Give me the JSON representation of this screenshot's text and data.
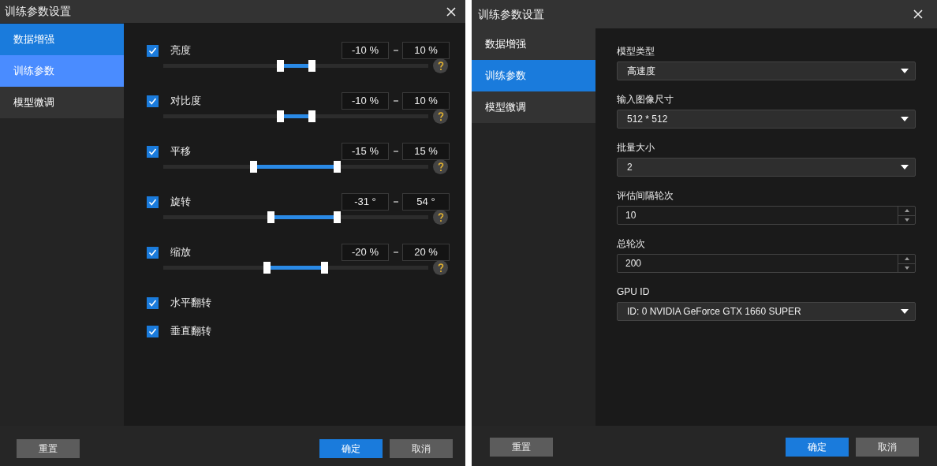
{
  "dialogs": [
    {
      "title": "训练参数设置",
      "sidebar": {
        "items": [
          {
            "label": "数据增强",
            "selected": true,
            "hovered": false
          },
          {
            "label": "训练参数",
            "selected": false,
            "hovered": true
          },
          {
            "label": "模型微调",
            "selected": false,
            "hovered": false
          }
        ]
      },
      "content": {
        "kind": "augmentation",
        "rows": [
          {
            "label": "亮度",
            "checked": true,
            "min": "-10 %",
            "max": "10 %",
            "range": [
              {
                "level": 0.44
              },
              {
                "level": 0.56
              }
            ]
          },
          {
            "label": "对比度",
            "checked": true,
            "min": "-10 %",
            "max": "10 %",
            "range": [
              {
                "level": 0.44
              },
              {
                "level": 0.56
              }
            ]
          },
          {
            "label": "平移",
            "checked": true,
            "min": "-15 %",
            "max": "15 %",
            "range": [
              {
                "level": 0.34
              },
              {
                "level": 0.655
              }
            ]
          },
          {
            "label": "旋转",
            "checked": true,
            "min": "-31 °",
            "max": "54 °",
            "range": [
              {
                "level": 0.405
              },
              {
                "level": 0.655
              }
            ]
          },
          {
            "label": "缩放",
            "checked": true,
            "min": "-20 %",
            "max": "20 %",
            "range": [
              {
                "level": 0.39
              },
              {
                "level": 0.607
              }
            ]
          },
          {
            "label": "水平翻转",
            "checked": true
          },
          {
            "label": "垂直翻转",
            "checked": true
          }
        ]
      },
      "buttons": {
        "reset": "重置",
        "ok": "确定",
        "cancel": "取消"
      }
    },
    {
      "title": "训练参数设置",
      "sidebar": {
        "items": [
          {
            "label": "数据增强",
            "selected": false,
            "hovered": false
          },
          {
            "label": "训练参数",
            "selected": true,
            "hovered": false
          },
          {
            "label": "模型微调",
            "selected": false,
            "hovered": false
          }
        ]
      },
      "content": {
        "kind": "form",
        "fields": [
          {
            "label": "模型类型",
            "kind": "dropdown",
            "value": "高速度"
          },
          {
            "label": "输入图像尺寸",
            "kind": "dropdown",
            "value": "512 * 512"
          },
          {
            "label": "批量大小",
            "kind": "dropdown",
            "value": "2"
          },
          {
            "label": "评估间隔轮次",
            "kind": "spinner",
            "value": "10"
          },
          {
            "label": "总轮次",
            "kind": "spinner",
            "value": "200"
          },
          {
            "label": "GPU ID",
            "kind": "dropdown",
            "value": "ID: 0  NVIDIA GeForce GTX 1660 SUPER"
          }
        ]
      },
      "buttons": {
        "reset": "重置",
        "ok": "确定",
        "cancel": "取消"
      }
    }
  ]
}
